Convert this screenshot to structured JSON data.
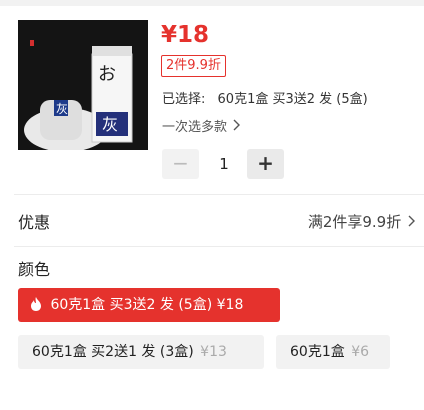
{
  "product": {
    "image_label": "product-image",
    "image_text": {
      "brand_vertical": "お…",
      "big_char": "灰"
    },
    "price": "¥18",
    "promo_badge": "2件9.9折",
    "selected_label": "已选择:",
    "selected_value": "60克1盒  买3送2 发 (5盒)",
    "multi_select": "一次选多款"
  },
  "quantity": {
    "minus": "−",
    "value": "1",
    "plus": "+"
  },
  "discount": {
    "label": "优惠",
    "text": "满2件享9.9折"
  },
  "color": {
    "label": "颜色",
    "options": [
      {
        "label": "60克1盒  买3送2 发 (5盒)",
        "price": "¥18",
        "selected": true
      },
      {
        "label": "60克1盒  买2送1 发 (3盒)",
        "price": "¥13",
        "selected": false
      },
      {
        "label": "60克1盒",
        "price": "¥6",
        "selected": false
      }
    ]
  },
  "colors": {
    "accent": "#e5322d",
    "muted_bg": "#f2f2f2"
  }
}
